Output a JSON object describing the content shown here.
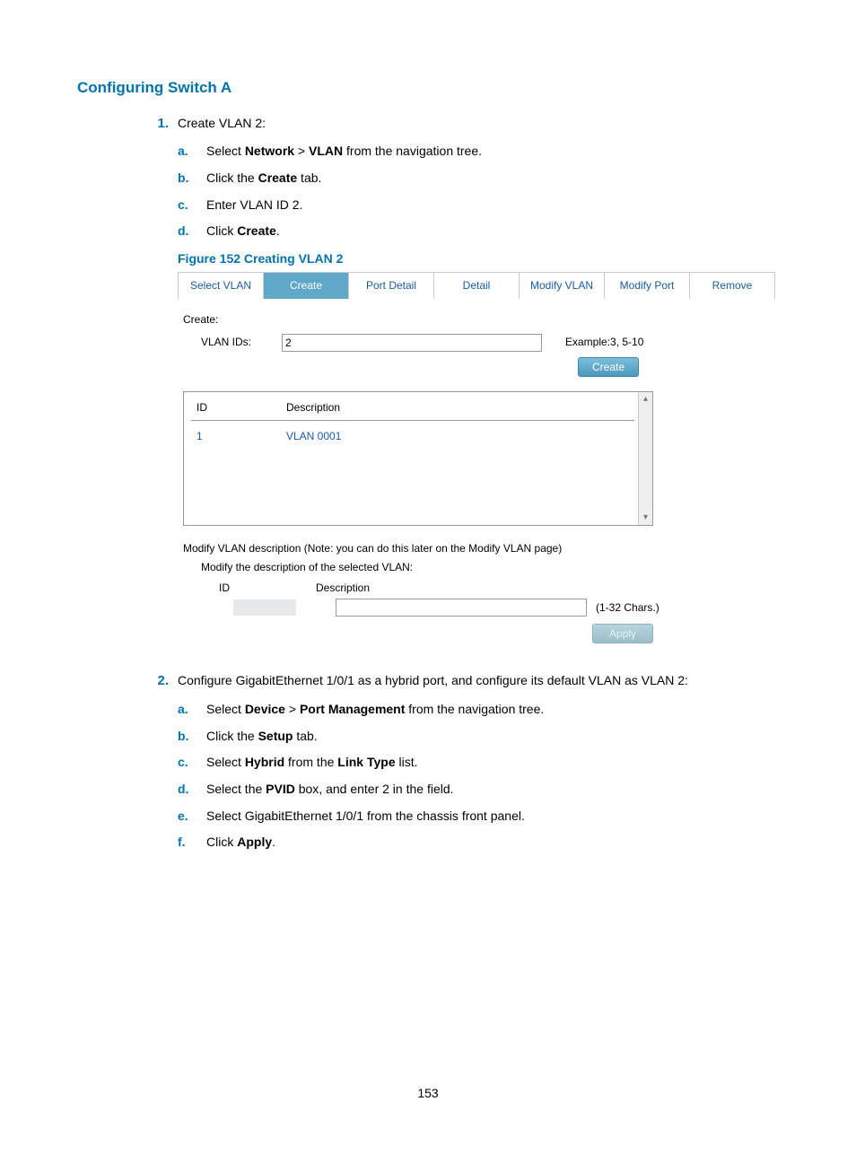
{
  "section_title": "Configuring Switch A",
  "page_number": "153",
  "step1": {
    "num": "1.",
    "text": "Create VLAN 2:",
    "a_marker": "a.",
    "a_pre": "Select ",
    "a_b1": "Network",
    "a_mid": " > ",
    "a_b2": "VLAN",
    "a_post": " from the navigation tree.",
    "b_marker": "b.",
    "b_pre": "Click the ",
    "b_b1": "Create",
    "b_post": " tab.",
    "c_marker": "c.",
    "c_text": "Enter VLAN ID 2.",
    "d_marker": "d.",
    "d_pre": "Click ",
    "d_b1": "Create",
    "d_post": ".",
    "fig_caption": "Figure 152 Creating VLAN 2"
  },
  "figure": {
    "tabs": {
      "select_vlan": "Select VLAN",
      "create": "Create",
      "port_detail": "Port Detail",
      "detail": "Detail",
      "modify_vlan": "Modify VLAN",
      "modify_port": "Modify Port",
      "remove": "Remove"
    },
    "create_label": "Create:",
    "vlan_ids_label": "VLAN IDs:",
    "vlan_ids_value": "2",
    "example_hint": "Example:3, 5-10",
    "create_button": "Create",
    "col_id": "ID",
    "col_desc": "Description",
    "row_id": "1",
    "row_desc": "VLAN 0001",
    "modify_note": "Modify VLAN description (Note: you can do this later on the Modify VLAN page)",
    "modify_sub": "Modify the description of the selected VLAN:",
    "mod_col_id": "ID",
    "mod_col_desc": "Description",
    "chars_hint": "(1-32 Chars.)",
    "apply_button": "Apply"
  },
  "step2": {
    "num": "2.",
    "text": "Configure GigabitEthernet 1/0/1 as a hybrid port, and configure its default VLAN as VLAN 2:",
    "a_marker": "a.",
    "a_pre": "Select ",
    "a_b1": "Device",
    "a_mid": " > ",
    "a_b2": "Port Management",
    "a_post": " from the navigation tree.",
    "b_marker": "b.",
    "b_pre": "Click the ",
    "b_b1": "Setup",
    "b_post": " tab.",
    "c_marker": "c.",
    "c_pre": "Select ",
    "c_b1": "Hybrid",
    "c_mid": " from the ",
    "c_b2": "Link Type",
    "c_post": " list.",
    "d_marker": "d.",
    "d_pre": "Select the ",
    "d_b1": "PVID",
    "d_post": " box, and enter 2 in the field.",
    "e_marker": "e.",
    "e_text": "Select GigabitEthernet 1/0/1 from the chassis front panel.",
    "f_marker": "f.",
    "f_pre": "Click ",
    "f_b1": "Apply",
    "f_post": "."
  }
}
